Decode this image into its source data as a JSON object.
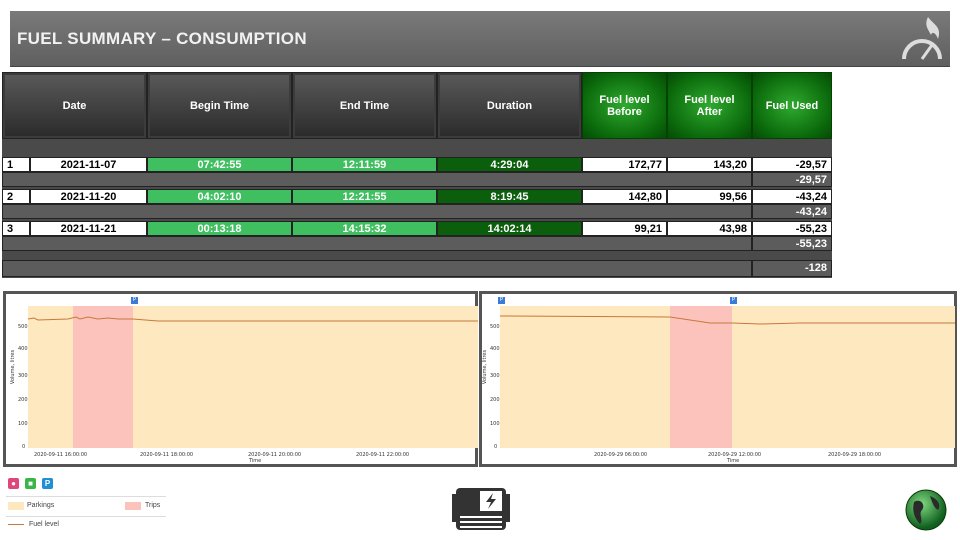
{
  "banner": {
    "title": "FUEL SUMMARY – CONSUMPTION"
  },
  "table": {
    "headers": [
      "Date",
      "Begin Time",
      "End Time",
      "Duration",
      "Fuel level Before",
      "Fuel level After",
      "Fuel Used"
    ],
    "rows": [
      {
        "num": "1",
        "date": "2021-11-07",
        "begin": "07:42:55",
        "end": "12:11:59",
        "duration": "4:29:04",
        "before": "172,77",
        "after": "143,20",
        "used": "-29,57",
        "subtotal": "-29,57"
      },
      {
        "num": "2",
        "date": "2021-11-20",
        "begin": "04:02:10",
        "end": "12:21:55",
        "duration": "8:19:45",
        "before": "142,80",
        "after": "99,56",
        "used": "-43,24",
        "subtotal": "-43,24"
      },
      {
        "num": "3",
        "date": "2021-11-21",
        "begin": "00:13:18",
        "end": "14:15:32",
        "duration": "14:02:14",
        "before": "99,21",
        "after": "43,98",
        "used": "-55,23",
        "subtotal": "-55,23"
      }
    ],
    "total": "-128"
  },
  "charts": [
    {
      "ylabel": "Volume, litres",
      "xlabel": "Time",
      "yticks": [
        "500",
        "400",
        "300",
        "200",
        "100",
        "0"
      ],
      "xticks": [
        "2020-09-11 16:00:00",
        "2020-09-11 18:00:00",
        "2020-09-11 20:00:00",
        "2020-09-11 22:00:00"
      ],
      "marker": "P"
    },
    {
      "ylabel": "Volume, litres",
      "xlabel": "Time",
      "yticks": [
        "500",
        "400",
        "300",
        "200",
        "100",
        "0"
      ],
      "xticks": [
        "2020-09-29 06:00:00",
        "2020-09-29 12:00:00",
        "2020-09-29 18:00:00"
      ],
      "marker": "P"
    }
  ],
  "legend": {
    "parkings": "Parkings",
    "trips": "Trips",
    "fuel_level": "Fuel level"
  },
  "colors": {
    "parkings": "#fde8c0",
    "trips": "#fcc3bd",
    "fuel": "#c8783a",
    "green": "#3fbf5f",
    "dark_green": "#0b5e0b"
  },
  "icons": [
    "fuel-drop-icon",
    "fuel-pump-icon",
    "parking-icon",
    "generator-icon",
    "globe-icon",
    "speedometer-flame-icon"
  ]
}
